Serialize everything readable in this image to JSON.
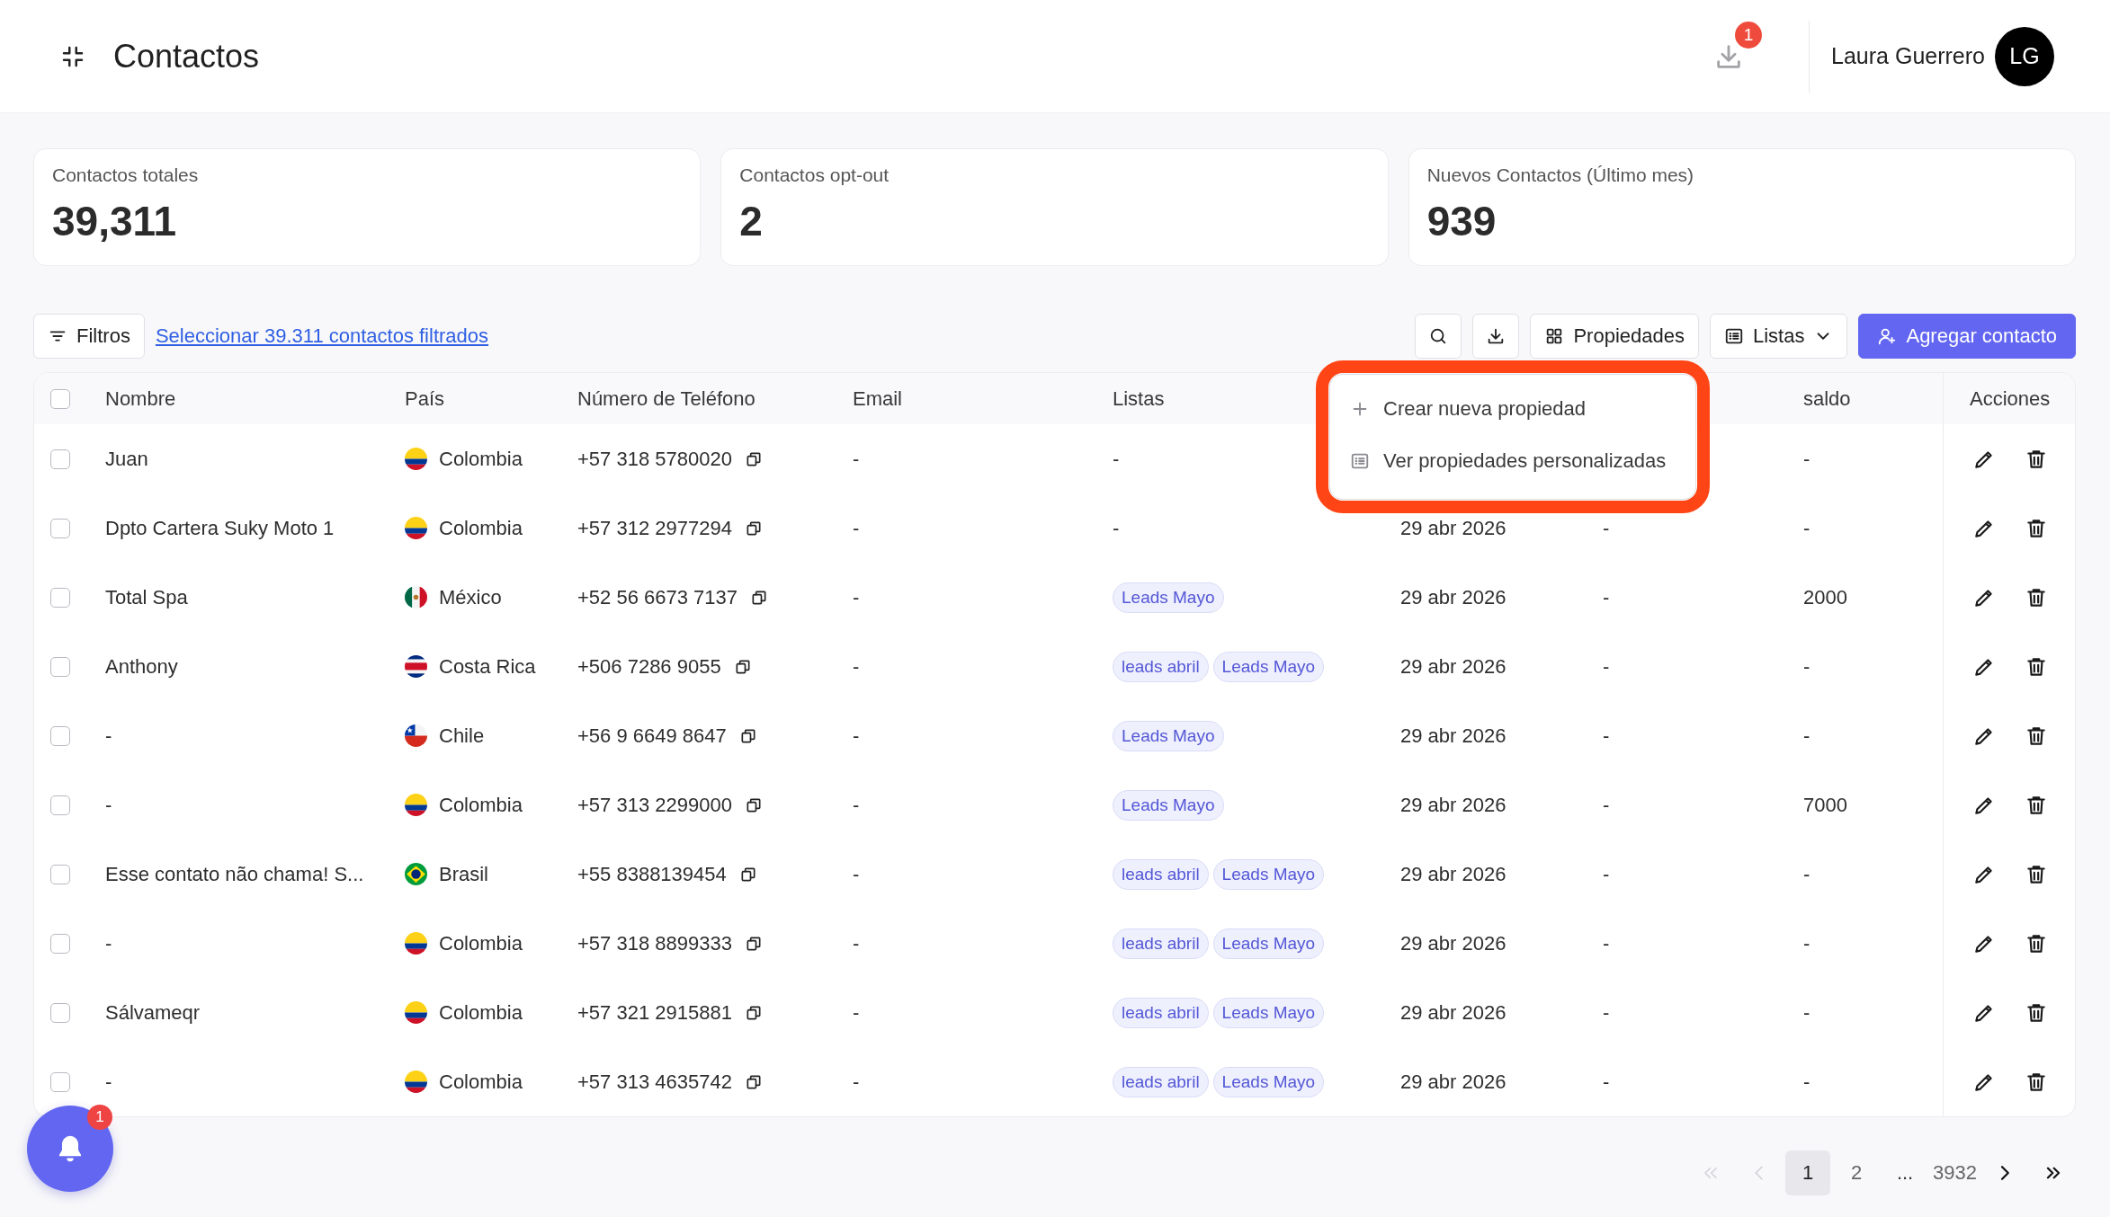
{
  "header": {
    "title": "Contactos",
    "downloads_badge": "1",
    "user": {
      "name": "Laura Guerrero",
      "initials": "LG"
    }
  },
  "stats": [
    {
      "label": "Contactos totales",
      "value": "39,311"
    },
    {
      "label": "Contactos opt-out",
      "value": "2"
    },
    {
      "label": "Nuevos Contactos (Último mes)",
      "value": "939"
    }
  ],
  "toolbar": {
    "filter_button": "Filtros",
    "select_link": "Seleccionar 39.311 contactos filtrados",
    "properties_button": "Propiedades",
    "lists_button": "Listas",
    "add_button": "Agregar contacto"
  },
  "properties_menu": {
    "items": [
      {
        "label": "Crear nueva propiedad"
      },
      {
        "label": "Ver propiedades personalizadas"
      }
    ]
  },
  "table": {
    "select_all": {
      "checked": false
    },
    "columns": [
      "Nombre",
      "País",
      "Número de Teléfono",
      "Email",
      "Listas",
      "saldo",
      "Acciones"
    ],
    "rows": [
      {
        "checked": false,
        "name": "Juan",
        "country": {
          "name": "Colombia",
          "kind": "co"
        },
        "phone": "+57 318 5780020",
        "email": "-",
        "lists_empty": "-",
        "saldo": "-"
      },
      {
        "checked": false,
        "name": "Dpto Cartera Suky Moto 1",
        "country": {
          "name": "Colombia",
          "kind": "co"
        },
        "phone": "+57 312 2977294",
        "email": "-",
        "lists_empty": "-",
        "column_6": "29 abr 2026",
        "column_7": "-",
        "saldo": "-"
      },
      {
        "checked": false,
        "name": "Total Spa",
        "country": {
          "name": "México",
          "kind": "mx"
        },
        "phone": "+52 56 6673 7137",
        "email": "-",
        "lists": [
          "Leads Mayo"
        ],
        "column_6": "29 abr 2026",
        "column_7": "-",
        "saldo": "2000"
      },
      {
        "checked": false,
        "name": "Anthony",
        "country": {
          "name": "Costa Rica",
          "kind": "cr"
        },
        "phone": "+506 7286 9055",
        "email": "-",
        "lists": [
          "leads abril",
          "Leads Mayo"
        ],
        "column_6": "29 abr 2026",
        "column_7": "-",
        "saldo": "-"
      },
      {
        "checked": false,
        "name": "-",
        "country": {
          "name": "Chile",
          "kind": "cl"
        },
        "phone": "+56 9 6649 8647",
        "email": "-",
        "lists": [
          "Leads Mayo"
        ],
        "column_6": "29 abr 2026",
        "column_7": "-",
        "saldo": "-"
      },
      {
        "checked": false,
        "name": "-",
        "country": {
          "name": "Colombia",
          "kind": "co"
        },
        "phone": "+57 313 2299000",
        "email": "-",
        "lists": [
          "Leads Mayo"
        ],
        "column_6": "29 abr 2026",
        "column_7": "-",
        "saldo": "7000"
      },
      {
        "checked": false,
        "name": "Esse contato não chama! S...",
        "country": {
          "name": "Brasil",
          "kind": "br"
        },
        "phone": "+55 8388139454",
        "email": "-",
        "lists": [
          "leads abril",
          "Leads Mayo"
        ],
        "column_6": "29 abr 2026",
        "column_7": "-",
        "saldo": "-"
      },
      {
        "checked": false,
        "name": "-",
        "country": {
          "name": "Colombia",
          "kind": "co"
        },
        "phone": "+57 318 8899333",
        "email": "-",
        "lists": [
          "leads abril",
          "Leads Mayo"
        ],
        "column_6": "29 abr 2026",
        "column_7": "-",
        "saldo": "-"
      },
      {
        "checked": false,
        "name": "Sálvameqr",
        "country": {
          "name": "Colombia",
          "kind": "co"
        },
        "phone": "+57 321 2915881",
        "email": "-",
        "lists": [
          "leads abril",
          "Leads Mayo"
        ],
        "column_6": "29 abr 2026",
        "column_7": "-",
        "saldo": "-"
      },
      {
        "checked": false,
        "name": "-",
        "country": {
          "name": "Colombia",
          "kind": "co"
        },
        "phone": "+57 313 4635742",
        "email": "-",
        "lists": [
          "leads abril",
          "Leads Mayo"
        ],
        "column_6": "29 abr 2026",
        "column_7": "-",
        "saldo": "-"
      }
    ]
  },
  "pagination": {
    "items": [
      {
        "kind": "first",
        "disabled": true
      },
      {
        "kind": "prev",
        "disabled": true
      },
      {
        "kind": "page",
        "label": "1",
        "selected": true,
        "disabled": false
      },
      {
        "kind": "page",
        "label": "2",
        "selected": false,
        "disabled": false
      },
      {
        "kind": "ellipsis",
        "label": "..."
      },
      {
        "kind": "page",
        "label": "3932",
        "selected": false,
        "disabled": false
      },
      {
        "kind": "next",
        "disabled": false
      },
      {
        "kind": "last",
        "disabled": false
      }
    ]
  },
  "notifications": {
    "badge": "1"
  }
}
